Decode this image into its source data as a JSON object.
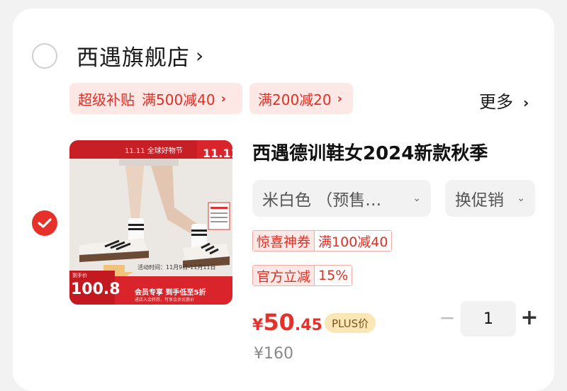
{
  "shop": {
    "name": "西遇旗舰店",
    "chevron": "›"
  },
  "promos": [
    {
      "label": "超级补贴",
      "detail": "满500减40",
      "chevron": "›"
    },
    {
      "label": "满200减20",
      "chevron": "›"
    }
  ],
  "more": {
    "label": "更多",
    "chevron": "›"
  },
  "product": {
    "title": "西遇德训鞋女2024新款秋季",
    "image": {
      "banner_text": "11.11 全球好物节",
      "price_label": "到手价",
      "price": "100.8",
      "date_text": "活动时间：11月9日-11月11日",
      "member_text": "会员专享 到手低至5折",
      "sub_text": "进店入会转券，可享会员优惠价"
    },
    "sku": {
      "label": "米白色 （预售…",
      "chevron": "⌄"
    },
    "promo_select": {
      "label": "换促销",
      "chevron": "⌄"
    },
    "coupons": [
      {
        "left": "惊喜神券",
        "right": "满100减40"
      },
      {
        "left": "官方立减",
        "right": "15%"
      }
    ],
    "price": {
      "currency": "¥",
      "integer": "50",
      "decimal": ".45"
    },
    "plus_badge": "PLUS价",
    "original_price": "¥160",
    "quantity": "1",
    "minus": "−",
    "plus": "+"
  },
  "colors": {
    "accent_red": "#e8302a",
    "promo_bg": "#fde8e6",
    "plus_badge_bg": "#fbe7b5"
  },
  "icons": {
    "shop_check": "unchecked-circle-icon",
    "item_check": "checked-circle-icon"
  }
}
